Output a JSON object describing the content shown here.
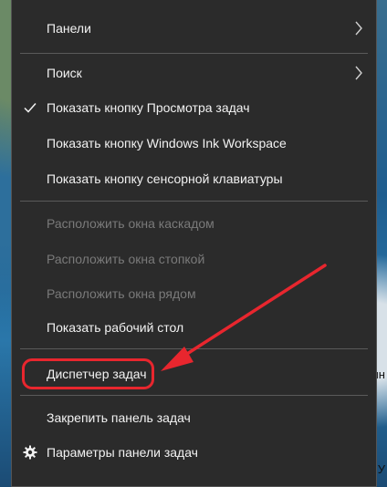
{
  "menu": {
    "items": [
      {
        "label": "Панели",
        "has_submenu": true,
        "checked": false,
        "enabled": true
      },
      {
        "label": "Поиск",
        "has_submenu": true,
        "checked": false,
        "enabled": true
      },
      {
        "label": "Показать кнопку Просмотра задач",
        "has_submenu": false,
        "checked": true,
        "enabled": true
      },
      {
        "label": "Показать кнопку Windows Ink Workspace",
        "has_submenu": false,
        "checked": false,
        "enabled": true
      },
      {
        "label": "Показать кнопку сенсорной клавиатуры",
        "has_submenu": false,
        "checked": false,
        "enabled": true
      },
      {
        "label": "Расположить окна каскадом",
        "has_submenu": false,
        "checked": false,
        "enabled": false
      },
      {
        "label": "Расположить окна стопкой",
        "has_submenu": false,
        "checked": false,
        "enabled": false
      },
      {
        "label": "Расположить окна рядом",
        "has_submenu": false,
        "checked": false,
        "enabled": false
      },
      {
        "label": "Показать рабочий стол",
        "has_submenu": false,
        "checked": false,
        "enabled": true
      },
      {
        "label": "Диспетчер задач",
        "has_submenu": false,
        "checked": false,
        "enabled": true,
        "highlighted": true
      },
      {
        "label": "Закрепить панель задач",
        "has_submenu": false,
        "checked": false,
        "enabled": true
      },
      {
        "label": "Параметры панели задач",
        "has_submenu": false,
        "checked": false,
        "enabled": true,
        "icon": "gear-icon"
      }
    ]
  },
  "background": {
    "fragment_1": "ин",
    "fragment_2": "У"
  },
  "colors": {
    "menu_bg": "#2b2b2b",
    "text": "#f2f2f2",
    "disabled_text": "#7a7a7a",
    "annotation": "#e8262e"
  }
}
